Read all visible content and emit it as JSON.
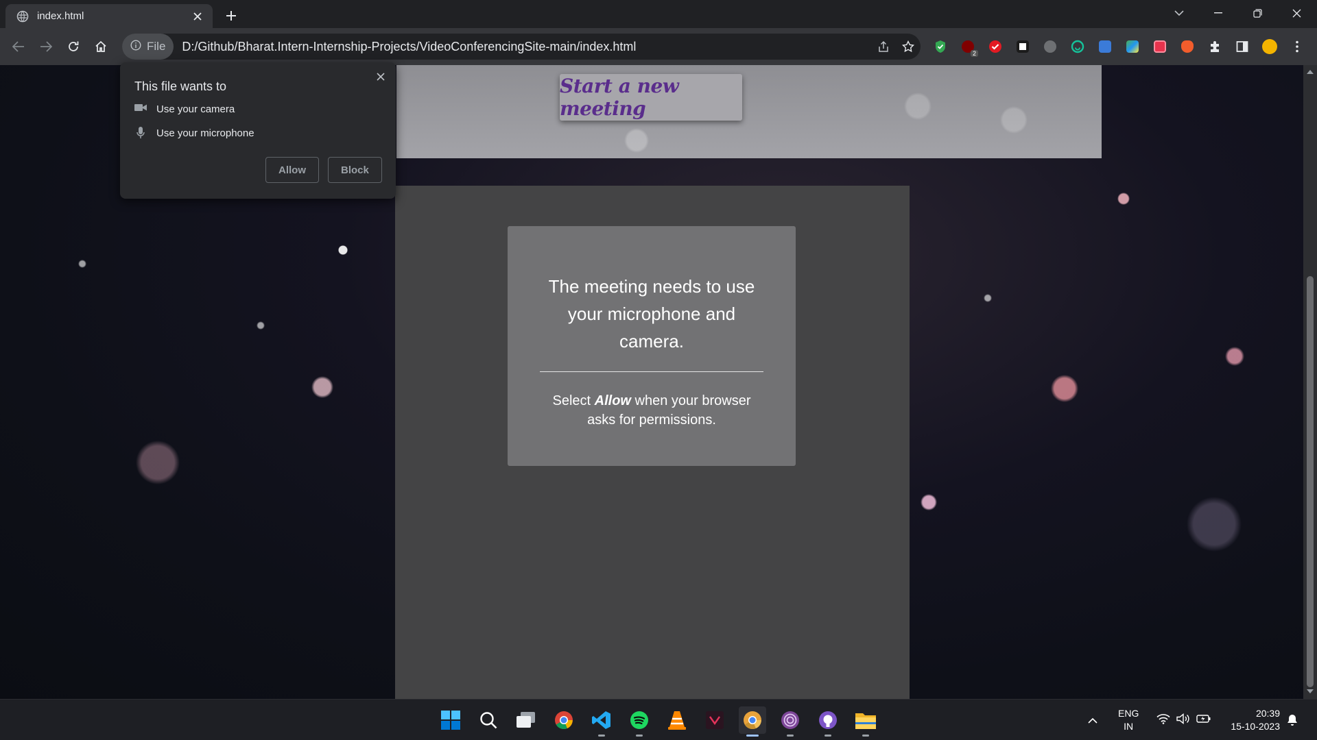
{
  "tab": {
    "title": "index.html"
  },
  "address_bar": {
    "chip_label": "File",
    "url": "D:/Github/Bharat.Intern-Internship-Projects/VideoConferencingSite-main/index.html"
  },
  "page": {
    "start_button_label": "Start a new meeting",
    "heading": "The meeting needs to use your microphone and camera.",
    "sub_before": "Select ",
    "sub_bold": "Allow",
    "sub_after": " when your browser asks for permissions."
  },
  "permission_popup": {
    "title": "This file wants to",
    "items": [
      {
        "label": "Use your camera",
        "icon": "camera-icon"
      },
      {
        "label": "Use your microphone",
        "icon": "microphone-icon"
      }
    ],
    "allow_label": "Allow",
    "block_label": "Block"
  },
  "extensions": [
    "shield-ext-icon",
    "ublock-ext-icon",
    "todoist-ext-icon",
    "notes-ext-icon",
    "puzzle-ext-icon",
    "grammarly-ext-icon",
    "window-ext-icon",
    "color-ext-icon",
    "capture-ext-icon",
    "brave-ext-icon",
    "extensions-icon",
    "sidepanel-icon",
    "profile-icon",
    "menu-icon"
  ],
  "extension_badge": "2",
  "taskbar": {
    "apps": [
      "start-icon",
      "search-icon",
      "task-view-icon",
      "chrome-icon",
      "vscode-icon",
      "spotify-icon",
      "vlc-icon",
      "app-icon",
      "chrome-canary-icon",
      "tor-icon",
      "github-icon",
      "file-explorer-icon"
    ],
    "lang_line1": "ENG",
    "lang_line2": "IN",
    "time": "20:39",
    "date": "15-10-2023"
  },
  "colors": {
    "start_button_text": "#5a2d8c",
    "panel": "#444445",
    "card": "#727274"
  }
}
